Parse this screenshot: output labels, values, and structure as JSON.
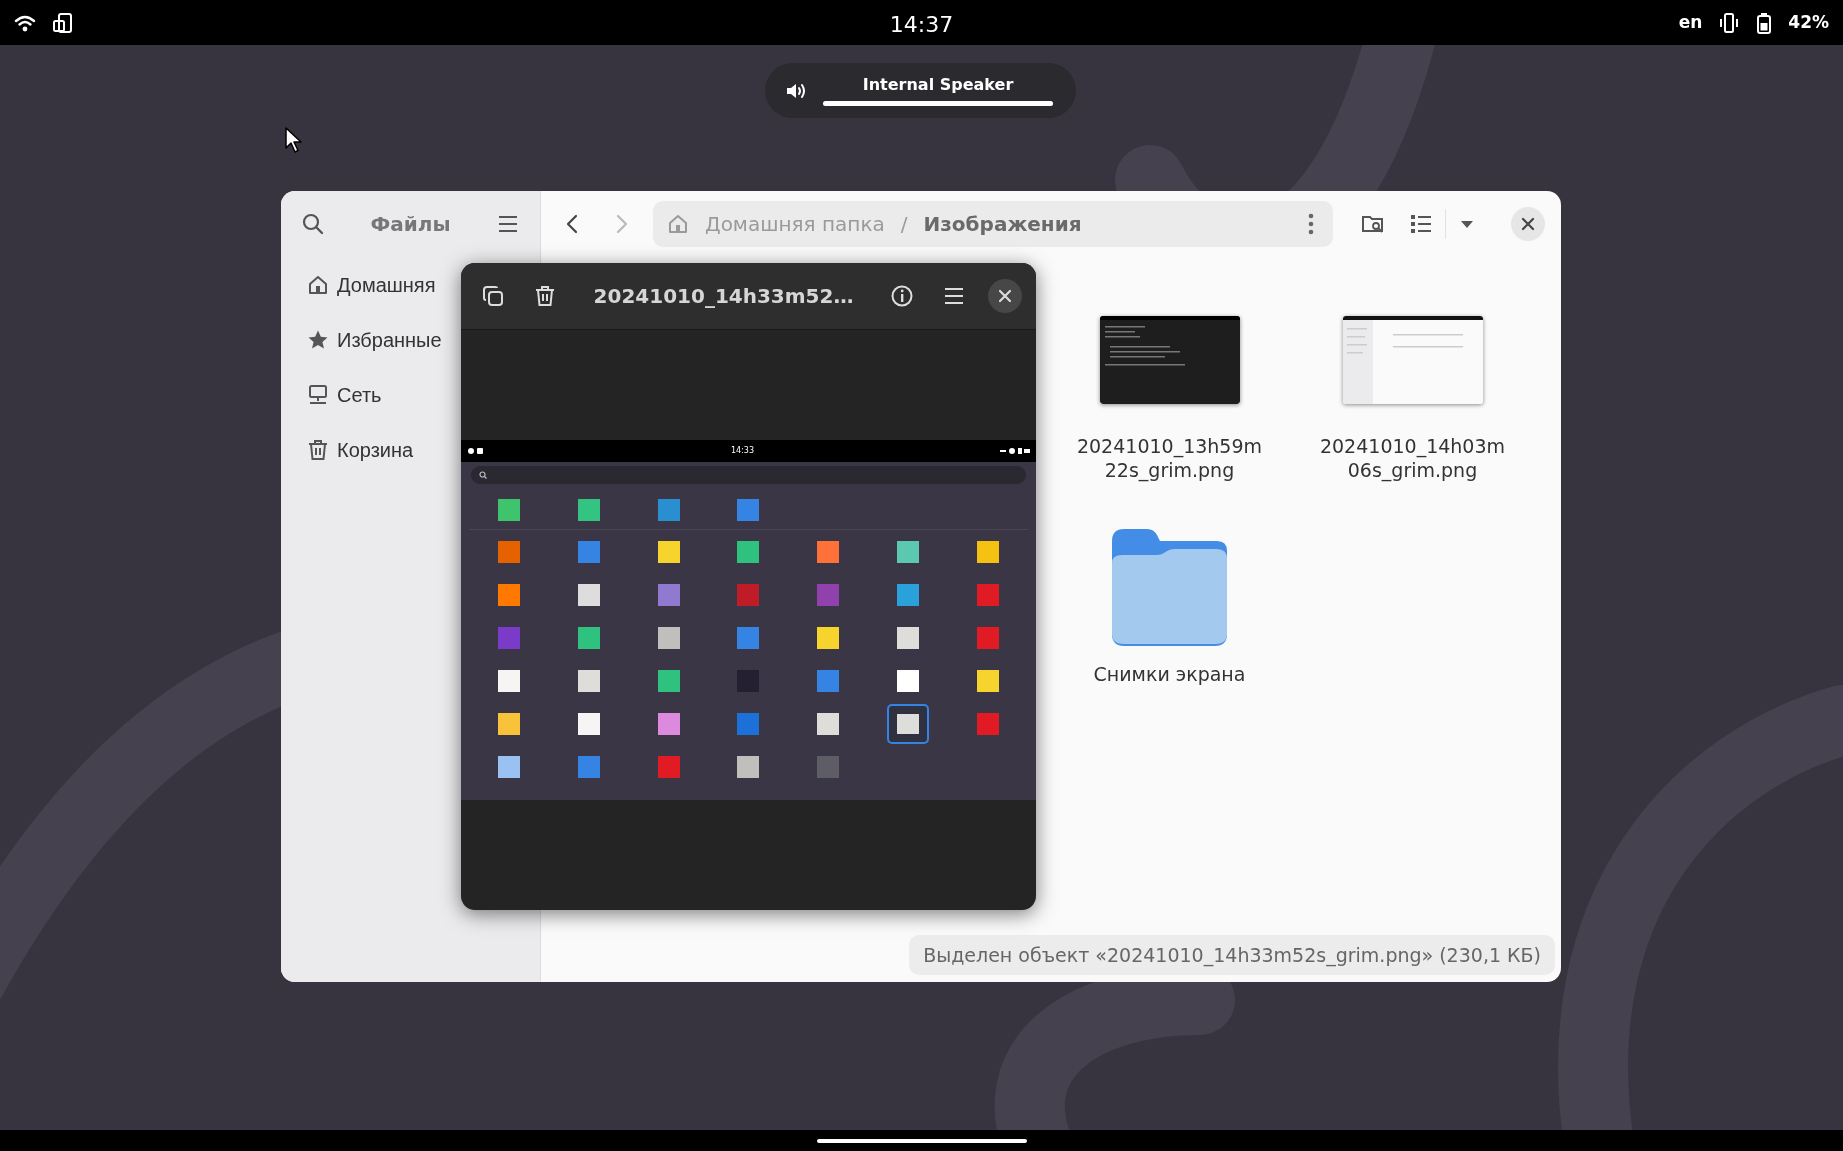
{
  "top_bar": {
    "time": "14:37",
    "keyboard_layout": "en",
    "battery_text": "42%"
  },
  "volume_osd": {
    "device": "Internal Speaker",
    "level": 1.0
  },
  "files_window": {
    "sidebar_title": "Файлы",
    "sidebar_items": [
      {
        "kind": "home",
        "label": "Домашняя",
        "selected": false
      },
      {
        "kind": "starred",
        "label": "Избранные",
        "selected": false
      },
      {
        "kind": "network",
        "label": "Сеть",
        "selected": false
      },
      {
        "kind": "trash",
        "label": "Корзина",
        "selected": false
      }
    ],
    "nav_buttons": [
      {
        "kind": "back",
        "disabled": false
      },
      {
        "kind": "forward",
        "disabled": true
      }
    ],
    "path_bar": {
      "separator": "/",
      "segments": [
        {
          "label": "Домашняя папка",
          "current": false
        },
        {
          "label": "Изображения",
          "current": true
        }
      ]
    },
    "items": [
      {
        "kind": "dark-image",
        "name": "20241010_13h59m22s_grim.png"
      },
      {
        "kind": "light-image",
        "name": "20241010_14h03m06s_grim.png"
      },
      {
        "kind": "folder",
        "name": "Снимки экрана"
      }
    ],
    "status": "Выделен объект «20241010_14h33m52s_grim.png»  (230,1 КБ)"
  },
  "image_viewer": {
    "title": "20241010_14h33m52…",
    "screenshot": {
      "time": "14:33",
      "dock": [
        {
          "color": "#3ec46d"
        },
        {
          "color": "#33c481"
        },
        {
          "color": "#2a8fd0"
        },
        {
          "color": "#3584e4"
        }
      ],
      "apps": [
        {
          "color": "#e66100",
          "selected": false
        },
        {
          "color": "#3584e4",
          "selected": false
        },
        {
          "color": "#f6d32d",
          "selected": false
        },
        {
          "color": "#2ec27e",
          "selected": false
        },
        {
          "color": "#ff7139",
          "selected": false
        },
        {
          "color": "#5bc8af",
          "selected": false
        },
        {
          "color": "#f5c211",
          "selected": false
        },
        {
          "color": "#ff7800",
          "selected": false
        },
        {
          "color": "#dddddd",
          "selected": false
        },
        {
          "color": "#8f7ad0",
          "selected": false
        },
        {
          "color": "#c01c28",
          "selected": false
        },
        {
          "color": "#9141ac",
          "selected": false
        },
        {
          "color": "#2aa1da",
          "selected": false
        },
        {
          "color": "#e01b24",
          "selected": false
        },
        {
          "color": "#7a3cc8",
          "selected": false
        },
        {
          "color": "#2ec27e",
          "selected": false
        },
        {
          "color": "#c0bfbc",
          "selected": false
        },
        {
          "color": "#3584e4",
          "selected": false
        },
        {
          "color": "#f6d32d",
          "selected": false
        },
        {
          "color": "#deddda",
          "selected": false
        },
        {
          "color": "#e01b24",
          "selected": false
        },
        {
          "color": "#f6f5f4",
          "selected": false
        },
        {
          "color": "#deddda",
          "selected": false
        },
        {
          "color": "#2ec27e",
          "selected": false
        },
        {
          "color": "#241f31",
          "selected": false
        },
        {
          "color": "#3584e4",
          "selected": false
        },
        {
          "color": "#ffffff",
          "selected": false
        },
        {
          "color": "#f6d32d",
          "selected": false
        },
        {
          "color": "#f8c33a",
          "selected": false
        },
        {
          "color": "#f6f5f4",
          "selected": false
        },
        {
          "color": "#dc8add",
          "selected": false
        },
        {
          "color": "#1c71d8",
          "selected": false
        },
        {
          "color": "#deddda",
          "selected": false
        },
        {
          "color": "#deddda",
          "selected": true
        },
        {
          "color": "#e01b24",
          "selected": false
        },
        {
          "color": "#99c1f1",
          "selected": false
        },
        {
          "color": "#3584e4",
          "selected": false
        },
        {
          "color": "#e01b24",
          "selected": false
        },
        {
          "color": "#c0bfbc",
          "selected": false
        },
        {
          "color": "#5e5c64",
          "selected": false
        }
      ]
    }
  }
}
